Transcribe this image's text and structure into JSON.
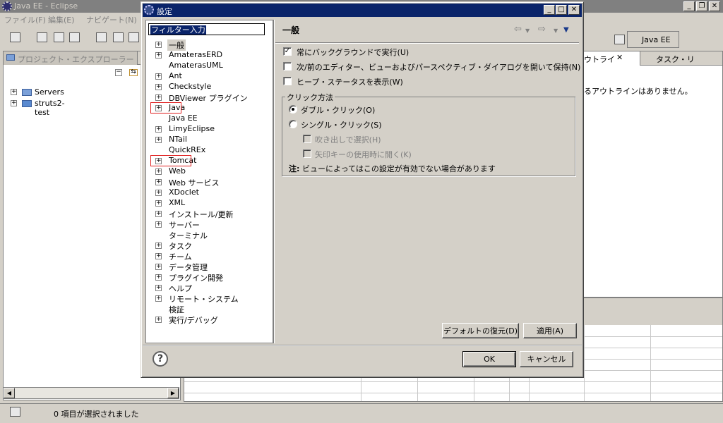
{
  "eclipse": {
    "title": "Java EE - Eclipse",
    "menu": [
      "ファイル(F)",
      "編集(E)",
      "ナビゲート(N)"
    ],
    "explorer": {
      "tab_label": "プロジェクト・エクスプローラー",
      "items": [
        "Servers",
        "struts2-test"
      ]
    },
    "perspective_label": "Java EE",
    "outline": {
      "tab_label": "ウトライ",
      "task_tab_label": "タスク・リ",
      "message": "るアウトラインはありません。"
    },
    "status_text": "0 項目が選択されました"
  },
  "dialog": {
    "title": "設定",
    "filter_value": "フィルター入力",
    "tree": [
      {
        "label": "一般",
        "expandable": true,
        "selected": true,
        "highlighted": false
      },
      {
        "label": "AmaterasERD",
        "expandable": true,
        "selected": false,
        "highlighted": false
      },
      {
        "label": "AmaterasUML",
        "expandable": false,
        "selected": false,
        "highlighted": false
      },
      {
        "label": "Ant",
        "expandable": true,
        "selected": false,
        "highlighted": false
      },
      {
        "label": "Checkstyle",
        "expandable": true,
        "selected": false,
        "highlighted": false
      },
      {
        "label": "DBViewer プラグイン",
        "expandable": true,
        "selected": false,
        "highlighted": false
      },
      {
        "label": "Java",
        "expandable": true,
        "selected": false,
        "highlighted": true
      },
      {
        "label": "Java EE",
        "expandable": false,
        "selected": false,
        "highlighted": false
      },
      {
        "label": "LimyEclipse",
        "expandable": true,
        "selected": false,
        "highlighted": false
      },
      {
        "label": "NTail",
        "expandable": true,
        "selected": false,
        "highlighted": false
      },
      {
        "label": "QuickREx",
        "expandable": false,
        "selected": false,
        "highlighted": false
      },
      {
        "label": "Tomcat",
        "expandable": true,
        "selected": false,
        "highlighted": true
      },
      {
        "label": "Web",
        "expandable": true,
        "selected": false,
        "highlighted": false
      },
      {
        "label": "Web サービス",
        "expandable": true,
        "selected": false,
        "highlighted": false
      },
      {
        "label": "XDoclet",
        "expandable": true,
        "selected": false,
        "highlighted": false
      },
      {
        "label": "XML",
        "expandable": true,
        "selected": false,
        "highlighted": false
      },
      {
        "label": "インストール/更新",
        "expandable": true,
        "selected": false,
        "highlighted": false
      },
      {
        "label": "サーバー",
        "expandable": true,
        "selected": false,
        "highlighted": false
      },
      {
        "label": "ターミナル",
        "expandable": false,
        "selected": false,
        "highlighted": false
      },
      {
        "label": "タスク",
        "expandable": true,
        "selected": false,
        "highlighted": false
      },
      {
        "label": "チーム",
        "expandable": true,
        "selected": false,
        "highlighted": false
      },
      {
        "label": "データ管理",
        "expandable": true,
        "selected": false,
        "highlighted": false
      },
      {
        "label": "プラグイン開発",
        "expandable": true,
        "selected": false,
        "highlighted": false
      },
      {
        "label": "ヘルプ",
        "expandable": true,
        "selected": false,
        "highlighted": false
      },
      {
        "label": "リモート・システム",
        "expandable": true,
        "selected": false,
        "highlighted": false
      },
      {
        "label": "検証",
        "expandable": false,
        "selected": false,
        "highlighted": false
      },
      {
        "label": "実行/デバッグ",
        "expandable": true,
        "selected": false,
        "highlighted": false
      }
    ],
    "page_title": "一般",
    "options": {
      "always_background": {
        "label": "常にバックグラウンドで実行(U)",
        "checked": true
      },
      "keep_next_prev": {
        "label": "次/前のエディター、ビューおよびパースペクティブ・ダイアログを開いて保持(N)",
        "checked": false
      },
      "show_heap": {
        "label": "ヒープ・ステータスを表示(W)",
        "checked": false
      }
    },
    "click_group": {
      "legend": "クリック方法",
      "double_click": {
        "label": "ダブル・クリック(O)",
        "selected": true
      },
      "single_click": {
        "label": "シングル・クリック(S)",
        "selected": false
      },
      "select_on_hover": {
        "label": "吹き出しで選択(H)",
        "checked": false
      },
      "open_on_arrow": {
        "label": "矢印キーの使用時に開く(K)",
        "checked": false
      },
      "note_bold": "注:",
      "note_text": "ビューによってはこの設定が有効でない場合があります"
    },
    "buttons": {
      "restore_defaults": "デフォルトの復元(D)",
      "apply": "適用(A)",
      "ok": "OK",
      "cancel": "キャンセル"
    }
  }
}
